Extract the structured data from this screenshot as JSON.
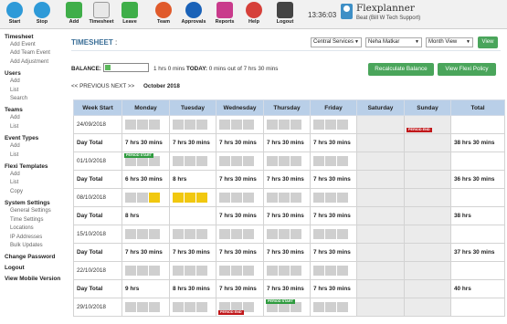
{
  "toolbar": {
    "buttons": [
      {
        "label": "Start",
        "icon": "start-icon"
      },
      {
        "label": "Stop",
        "icon": "stop-icon"
      },
      {
        "label": "Add",
        "icon": "add-icon"
      },
      {
        "label": "Timesheet",
        "icon": "timesheet-icon"
      },
      {
        "label": "Leave",
        "icon": "leave-icon"
      },
      {
        "label": "Team",
        "icon": "team-icon"
      },
      {
        "label": "Approvals",
        "icon": "approvals-icon"
      },
      {
        "label": "Reports",
        "icon": "reports-icon"
      },
      {
        "label": "Help",
        "icon": "help-icon"
      },
      {
        "label": "Logout",
        "icon": "logout-icon"
      }
    ],
    "clock": "13:36:03",
    "app_title": "Flexplanner",
    "app_user": "Beat (Bill W Tech Support)"
  },
  "sidebar": {
    "sections": [
      {
        "heading": "Timesheet",
        "items": [
          "Add Event",
          "Add Team Event",
          "Add Adjustment"
        ]
      },
      {
        "heading": "Users",
        "items": [
          "Add",
          "List",
          "Search"
        ]
      },
      {
        "heading": "Teams",
        "items": [
          "Add",
          "List"
        ]
      },
      {
        "heading": "Event Types",
        "items": [
          "Add",
          "List"
        ]
      },
      {
        "heading": "Flexi Templates",
        "items": [
          "Add",
          "List",
          "Copy"
        ]
      },
      {
        "heading": "System Settings",
        "items": [
          "General Settings",
          "Time Settings",
          "Locations",
          "IP Addresses",
          "Bulk Updates"
        ]
      },
      {
        "heading": "Change Password",
        "items": []
      },
      {
        "heading": "Logout",
        "items": []
      },
      {
        "heading": "View Mobile Version",
        "items": []
      }
    ]
  },
  "header": {
    "title": "TIMESHEET",
    "title_suffix": ":",
    "filter_team": "Central Services",
    "filter_user": "Neha Matkar",
    "filter_view": "Month View",
    "view_button": "View"
  },
  "balance": {
    "label": "BALANCE:",
    "progress_fraction": 0.12,
    "hours_text": "1 hrs 0 mins",
    "today_label": "TODAY:",
    "today_text": "0 mins out of 7 hrs 30 mins",
    "recalc_button": "Recalculate Balance",
    "flexi_button": "View Flexi Policy"
  },
  "pager": {
    "prev_label": "<< PREVIOUS",
    "next_label": "NEXT >>",
    "month_label": "October 2018"
  },
  "grid": {
    "columns": [
      "Week Start",
      "Monday",
      "Tuesday",
      "Wednesday",
      "Thursday",
      "Friday",
      "Saturday",
      "Sunday",
      "Total"
    ],
    "rows": [
      {
        "kind": "week",
        "label": "24/09/2018",
        "cells": [
          {
            "slots": [
              "grey",
              "grey",
              "grey"
            ]
          },
          {
            "slots": [
              "grey",
              "grey",
              "grey"
            ]
          },
          {
            "slots": [
              "grey",
              "grey",
              "grey"
            ]
          },
          {
            "slots": [
              "grey",
              "grey",
              "grey"
            ]
          },
          {
            "slots": [
              "grey",
              "grey",
              "grey"
            ]
          },
          {
            "slots": []
          },
          {
            "slots": [],
            "marker": "PERIOD END",
            "marker_kind": "end"
          },
          {
            "slots": []
          }
        ]
      },
      {
        "kind": "total",
        "label": "Day Total",
        "cells": [
          "7 hrs 30 mins",
          "7 hrs 30 mins",
          "7 hrs 30 mins",
          "7 hrs 30 mins",
          "7 hrs 30 mins",
          "",
          "",
          "38 hrs 30 mins"
        ]
      },
      {
        "kind": "week",
        "label": "01/10/2018",
        "cells": [
          {
            "slots": [
              "grey",
              "grey",
              "grey"
            ],
            "marker": "PERIOD START",
            "marker_kind": "start"
          },
          {
            "slots": [
              "grey",
              "grey",
              "grey"
            ]
          },
          {
            "slots": [
              "grey",
              "grey",
              "grey"
            ]
          },
          {
            "slots": [
              "grey",
              "grey",
              "grey"
            ]
          },
          {
            "slots": [
              "grey",
              "grey",
              "grey"
            ]
          },
          {
            "slots": []
          },
          {
            "slots": []
          },
          {
            "slots": []
          }
        ]
      },
      {
        "kind": "total",
        "label": "Day Total",
        "cells": [
          "6 hrs 30 mins",
          "8 hrs",
          "7 hrs 30 mins",
          "7 hrs 30 mins",
          "7 hrs 30 mins",
          "",
          "",
          "36 hrs 30 mins"
        ]
      },
      {
        "kind": "week",
        "label": "08/10/2018",
        "cells": [
          {
            "slots": [
              "grey",
              "grey",
              "yellow"
            ]
          },
          {
            "slots": [
              "yellow",
              "yellow",
              "yellow"
            ]
          },
          {
            "slots": [
              "grey",
              "grey",
              "grey"
            ]
          },
          {
            "slots": [
              "grey",
              "grey",
              "grey"
            ]
          },
          {
            "slots": [
              "grey",
              "grey",
              "grey"
            ]
          },
          {
            "slots": []
          },
          {
            "slots": []
          },
          {
            "slots": []
          }
        ]
      },
      {
        "kind": "total",
        "label": "Day Total",
        "cells": [
          "8 hrs",
          "",
          "7 hrs 30 mins",
          "7 hrs 30 mins",
          "7 hrs 30 mins",
          "",
          "",
          "38 hrs"
        ]
      },
      {
        "kind": "week",
        "label": "15/10/2018",
        "cells": [
          {
            "slots": [
              "grey",
              "grey",
              "grey"
            ]
          },
          {
            "slots": [
              "grey",
              "grey",
              "grey"
            ]
          },
          {
            "slots": [
              "grey",
              "grey",
              "grey"
            ]
          },
          {
            "slots": [
              "grey",
              "grey",
              "grey"
            ]
          },
          {
            "slots": [
              "grey",
              "grey",
              "grey"
            ]
          },
          {
            "slots": []
          },
          {
            "slots": []
          },
          {
            "slots": []
          }
        ]
      },
      {
        "kind": "total",
        "label": "Day Total",
        "cells": [
          "7 hrs 30 mins",
          "7 hrs 30 mins",
          "7 hrs 30 mins",
          "7 hrs 30 mins",
          "7 hrs 30 mins",
          "",
          "",
          "37 hrs 30 mins"
        ]
      },
      {
        "kind": "week",
        "label": "22/10/2018",
        "cells": [
          {
            "slots": [
              "grey",
              "grey",
              "grey"
            ]
          },
          {
            "slots": [
              "grey",
              "grey",
              "grey"
            ]
          },
          {
            "slots": [
              "grey",
              "grey",
              "grey"
            ]
          },
          {
            "slots": [
              "grey",
              "grey",
              "grey"
            ]
          },
          {
            "slots": [
              "grey",
              "grey",
              "grey"
            ]
          },
          {
            "slots": []
          },
          {
            "slots": []
          },
          {
            "slots": []
          }
        ]
      },
      {
        "kind": "total",
        "label": "Day Total",
        "cells": [
          "9 hrs",
          "8 hrs 30 mins",
          "7 hrs 30 mins",
          "7 hrs 30 mins",
          "7 hrs 30 mins",
          "",
          "",
          "40 hrs"
        ]
      },
      {
        "kind": "week",
        "label": "29/10/2018",
        "cells": [
          {
            "slots": [
              "grey",
              "grey",
              "grey"
            ]
          },
          {
            "slots": [
              "grey",
              "grey",
              "grey"
            ]
          },
          {
            "slots": [
              "grey",
              "grey",
              "grey"
            ],
            "marker": "PERIOD END",
            "marker_kind": "end"
          },
          {
            "slots": [
              "grey",
              "grey",
              "grey"
            ],
            "marker": "PERIOD START",
            "marker_kind": "start"
          },
          {
            "slots": [
              "grey",
              "grey",
              "grey"
            ]
          },
          {
            "slots": []
          },
          {
            "slots": []
          },
          {
            "slots": []
          }
        ]
      }
    ]
  },
  "colors": {
    "accent_blue": "#3a6e97",
    "header_blue": "#b9cfe8",
    "button_green": "#4aa55b",
    "period_end_red": "#c0171a",
    "period_start_green": "#2f9b3f",
    "leave_yellow": "#f1c80f"
  }
}
